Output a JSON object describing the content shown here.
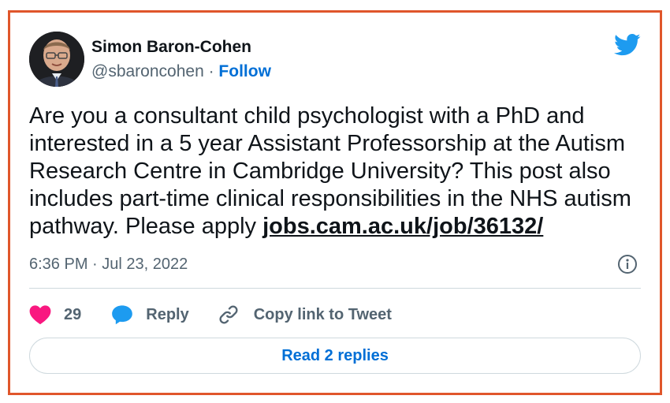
{
  "author": {
    "name": "Simon Baron-Cohen",
    "handle": "@sbaroncohen",
    "separator": " · ",
    "follow_label": "Follow"
  },
  "tweet": {
    "text": "Are you a consultant child psychologist with a PhD and interested in a 5 year Assistant Professorship at the Autism Research Centre in Cambridge University? This post also includes part-time clinical responsibilities in the NHS autism pathway. Please apply ",
    "link_text": "jobs.cam.ac.uk/job/36132/",
    "timestamp": "6:36 PM · Jul 23, 2022"
  },
  "actions": {
    "like_count": "29",
    "reply_label": "Reply",
    "copy_label": "Copy link to Tweet"
  },
  "replies_button": {
    "label": "Read 2 replies"
  },
  "icons": {
    "brand": "twitter-bird-icon",
    "like": "heart-icon",
    "reply": "speech-bubble-icon",
    "copy": "link-icon",
    "info": "info-icon"
  },
  "colors": {
    "frame_border": "#e0562b",
    "brand_blue": "#1d9bf0",
    "link_blue": "#006fd6",
    "heart_pink": "#f91880",
    "muted_text": "#536471",
    "text": "#0f1419"
  }
}
